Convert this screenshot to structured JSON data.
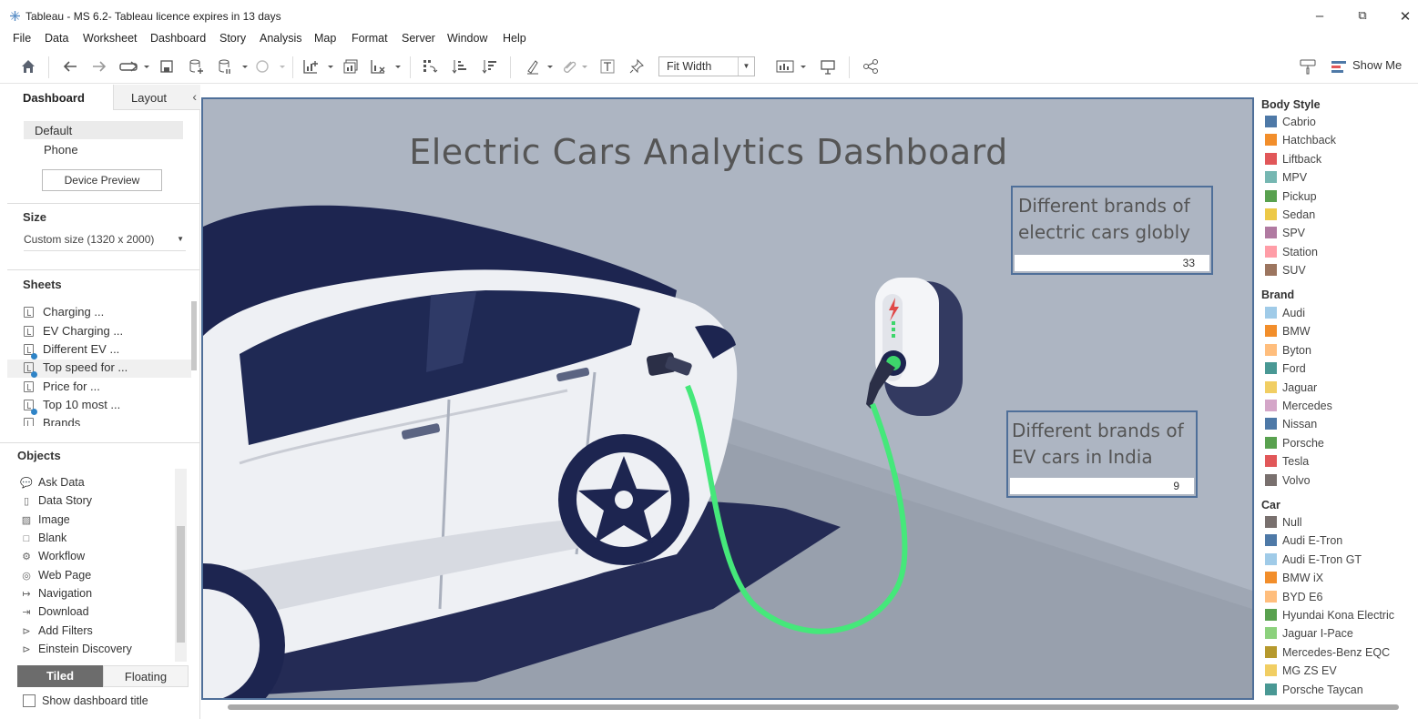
{
  "window": {
    "title": "Tableau - MS 6.2- Tableau licence expires in 13 days",
    "minimize": "–",
    "maximize": "⧉",
    "close": "✕"
  },
  "menu": [
    "File",
    "Data",
    "Worksheet",
    "Dashboard",
    "Story",
    "Analysis",
    "Map",
    "Format",
    "Server",
    "Window",
    "Help"
  ],
  "toolbar": {
    "fit": "Fit Width",
    "show_me": "Show Me"
  },
  "left_pane": {
    "tab_dashboard": "Dashboard",
    "tab_layout": "Layout",
    "device_default": "Default",
    "device_phone": "Phone",
    "device_preview": "Device Preview",
    "size_header": "Size",
    "size_value": "Custom size (1320 x 2000)",
    "sheets_header": "Sheets",
    "sheets": [
      "Charging ...",
      "EV Charging ...",
      "Different EV ...",
      "Top speed for ...",
      "Price for ...",
      "Top 10 most ...",
      "Brands"
    ],
    "objects_header": "Objects",
    "objects": [
      "Ask Data",
      "Data Story",
      "Image",
      "Blank",
      "Workflow",
      "Web Page",
      "Navigation",
      "Download",
      "Add Filters",
      "Einstein Discovery"
    ],
    "tiled": "Tiled",
    "floating": "Floating",
    "show_title": "Show dashboard title"
  },
  "dashboard": {
    "title": "Electric Cars Analytics Dashboard",
    "kpi_global_label": "Different brands of electric cars globly",
    "kpi_global_value": "33",
    "kpi_india_label": "Different brands of EV cars in India",
    "kpi_india_value": "9"
  },
  "legend": {
    "body_style_header": "Body Style",
    "body_style": [
      {
        "label": "Cabrio",
        "color": "#4e79a7"
      },
      {
        "label": "Hatchback",
        "color": "#f28e2b"
      },
      {
        "label": "Liftback",
        "color": "#e15759"
      },
      {
        "label": "MPV",
        "color": "#76b7b2"
      },
      {
        "label": "Pickup",
        "color": "#59a14f"
      },
      {
        "label": "Sedan",
        "color": "#edc948"
      },
      {
        "label": "SPV",
        "color": "#b07aa1"
      },
      {
        "label": "Station",
        "color": "#ff9da7"
      },
      {
        "label": "SUV",
        "color": "#9c755f"
      }
    ],
    "brand_header": "Brand",
    "brand": [
      {
        "label": "Audi",
        "color": "#a0cbe8"
      },
      {
        "label": "BMW",
        "color": "#f28e2b"
      },
      {
        "label": "Byton",
        "color": "#ffbe7d"
      },
      {
        "label": "Ford",
        "color": "#499894"
      },
      {
        "label": "Jaguar",
        "color": "#f1ce63"
      },
      {
        "label": "Mercedes",
        "color": "#d4a6c8"
      },
      {
        "label": "Nissan",
        "color": "#4e79a7"
      },
      {
        "label": "Porsche",
        "color": "#59a14f"
      },
      {
        "label": "Tesla",
        "color": "#e15759"
      },
      {
        "label": "Volvo",
        "color": "#79706e"
      }
    ],
    "car_header": "Car",
    "car": [
      {
        "label": "Null",
        "color": "#79706e"
      },
      {
        "label": "Audi E-Tron",
        "color": "#4e79a7"
      },
      {
        "label": "Audi E-Tron GT",
        "color": "#a0cbe8"
      },
      {
        "label": "BMW iX",
        "color": "#f28e2b"
      },
      {
        "label": "BYD E6",
        "color": "#ffbe7d"
      },
      {
        "label": "Hyundai Kona Electric",
        "color": "#59a14f"
      },
      {
        "label": "Jaguar I-Pace",
        "color": "#8cd17d"
      },
      {
        "label": "Mercedes-Benz EQC",
        "color": "#b6992d"
      },
      {
        "label": "MG ZS EV",
        "color": "#f1ce63"
      },
      {
        "label": "Porsche Taycan",
        "color": "#499894"
      }
    ]
  }
}
